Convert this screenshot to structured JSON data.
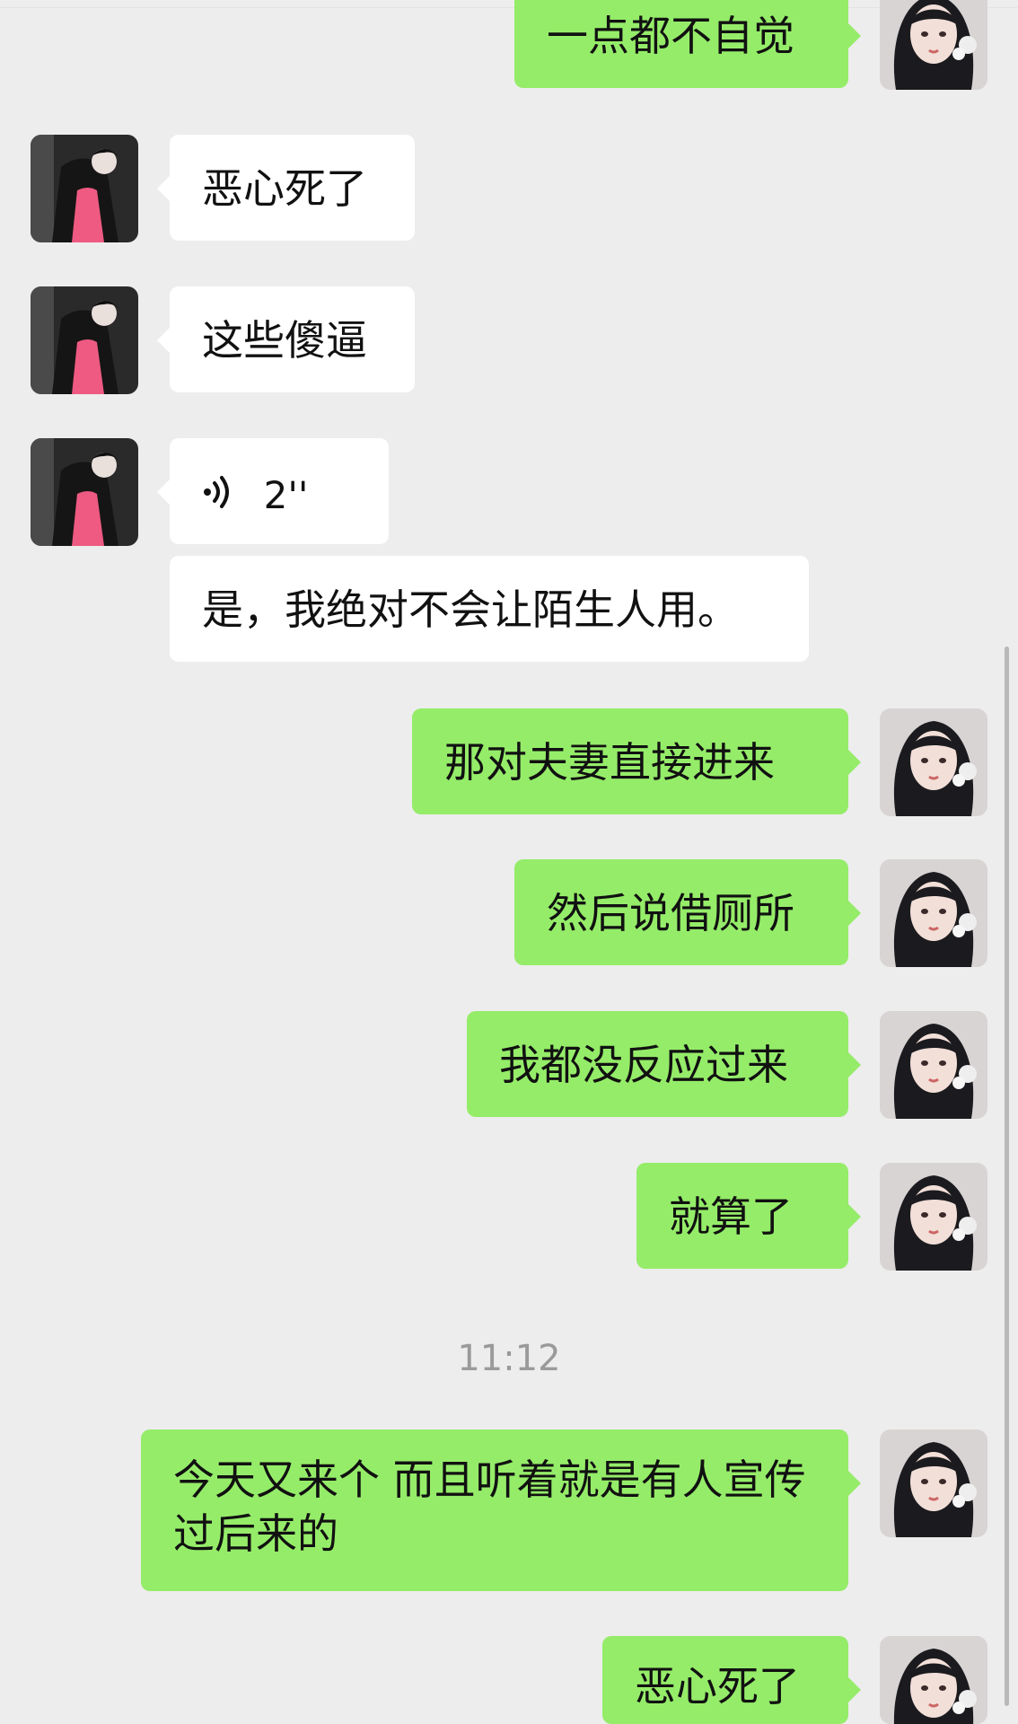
{
  "chat": {
    "messages": [
      {
        "id": "m1",
        "side": "out",
        "type": "text",
        "text": "一点都不自觉"
      },
      {
        "id": "m2",
        "side": "in",
        "type": "text",
        "text": "恶心死了"
      },
      {
        "id": "m3",
        "side": "in",
        "type": "text",
        "text": "这些傻逼"
      },
      {
        "id": "m4",
        "side": "in",
        "type": "voice",
        "duration": "2''"
      },
      {
        "id": "m5",
        "side": "in",
        "type": "text",
        "text": "是，我绝对不会让陌生人用。"
      },
      {
        "id": "m6",
        "side": "out",
        "type": "text",
        "text": "那对夫妻直接进来"
      },
      {
        "id": "m7",
        "side": "out",
        "type": "text",
        "text": "然后说借厕所"
      },
      {
        "id": "m8",
        "side": "out",
        "type": "text",
        "text": "我都没反应过来"
      },
      {
        "id": "m9",
        "side": "out",
        "type": "text",
        "text": "就算了"
      },
      {
        "id": "m10",
        "side": "out",
        "type": "text",
        "text": "今天又来个 而且听着就是有人宣传过后来的"
      },
      {
        "id": "m11",
        "side": "out",
        "type": "text",
        "text": "恶心死了"
      }
    ],
    "time_divider": "11:12",
    "bubble_colors": {
      "incoming": "#ffffff",
      "outgoing": "#95ec69"
    },
    "background_color": "#ededed"
  }
}
